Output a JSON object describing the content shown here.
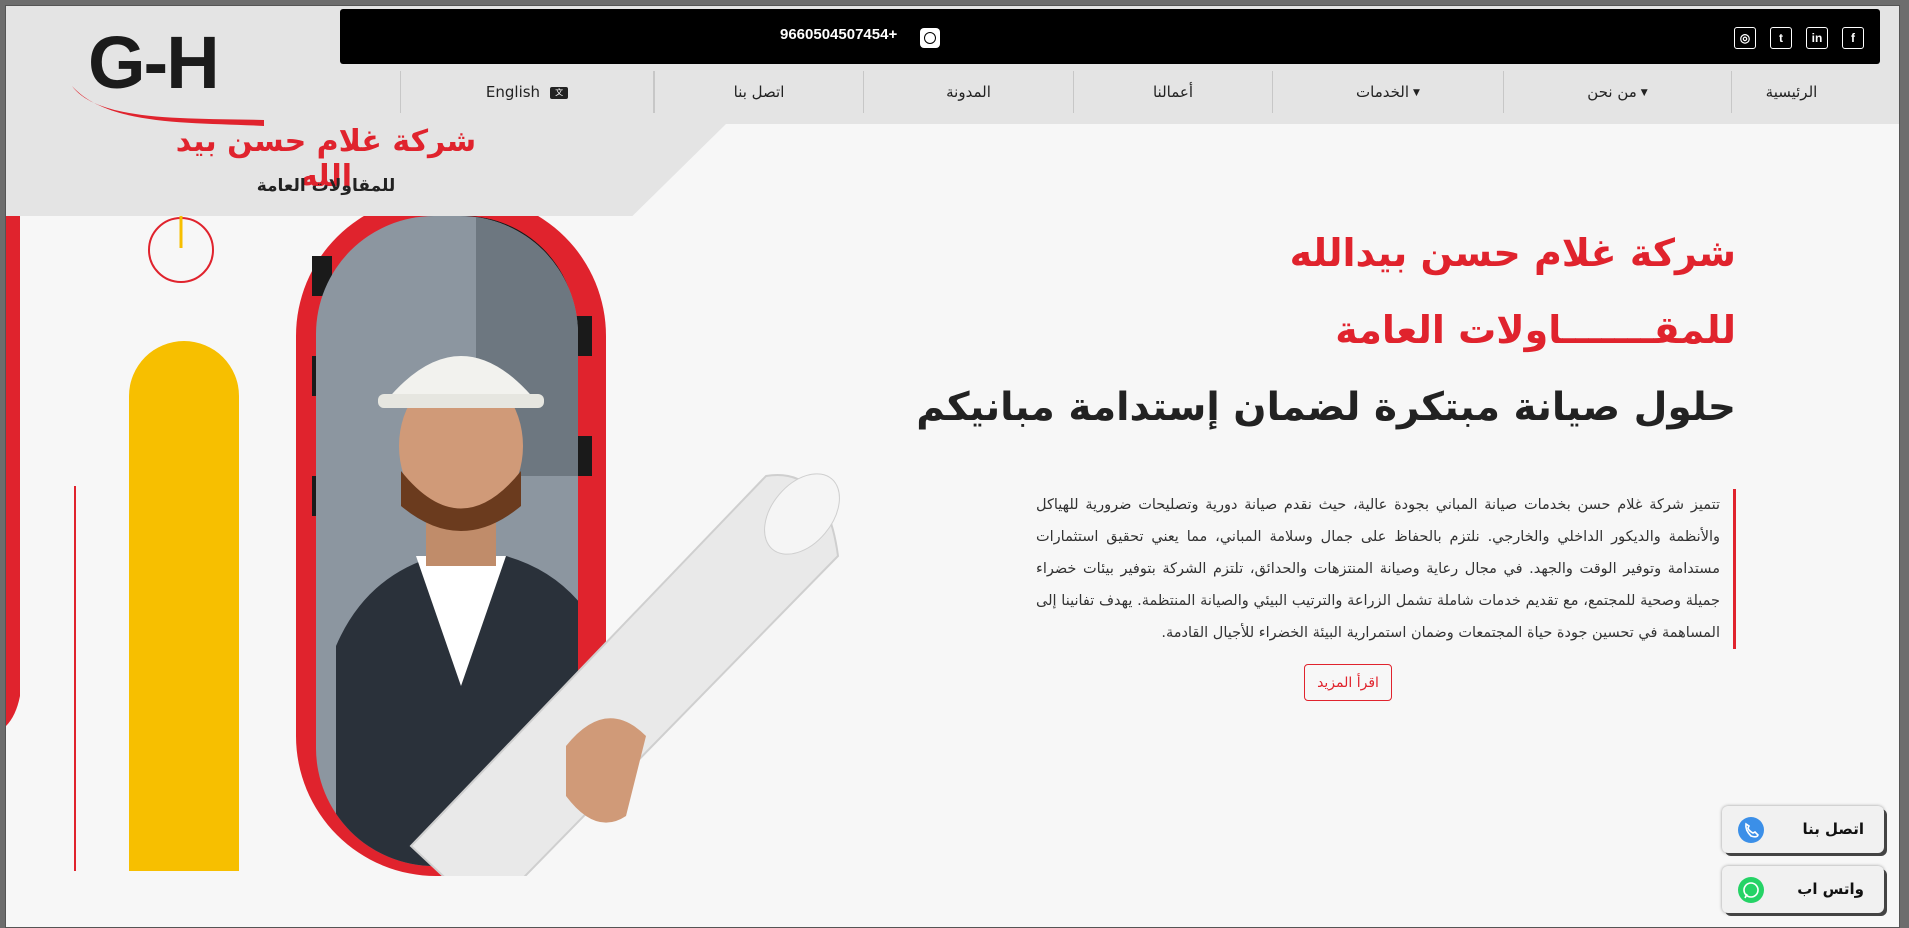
{
  "topbar": {
    "phone": "9660504507454+",
    "social": [
      "facebook",
      "linkedin",
      "twitter",
      "instagram"
    ]
  },
  "nav": {
    "home": "الرئيسية",
    "about": "من نحن",
    "services": "الخدمات",
    "works": "أعمالنا",
    "blog": "المدونة",
    "contact": "اتصل بنا",
    "language": "English"
  },
  "logo": {
    "mark": "G-H",
    "name": "شركة غلام حسن بيد الله",
    "subtitle": "للمقاولات العامة"
  },
  "hero": {
    "title_line1": "شركة غلام حسن بيدالله",
    "title_line2": "للمقـــــــاولات العامة",
    "title_line3": "حلول صيانة مبتكرة لضمان إستدامة مبانيكم",
    "body": "تتميز شركة غلام حسن بخدمات صيانة المباني بجودة عالية، حيث نقدم صيانة دورية وتصليحات ضرورية للهياكل والأنظمة والديكور الداخلي والخارجي. نلتزم بالحفاظ على جمال وسلامة المباني، مما يعني تحقيق استثمارات مستدامة وتوفير الوقت والجهد. في مجال رعاية وصيانة المنتزهات والحدائق، تلتزم الشركة بتوفير بيئات خضراء جميلة وصحية للمجتمع، مع تقديم خدمات شاملة تشمل الزراعة والترتيب البيئي والصيانة المنتظمة. يهدف تفانينا إلى المساهمة في تحسين جودة حياة المجتمعات وضمان استمرارية البيئة الخضراء للأجيال القادمة.",
    "read_more": "اقرأ المزيد"
  },
  "floating": {
    "call": "اتصل بنا",
    "whatsapp": "واتس اب"
  },
  "colors": {
    "accent": "#e0232d",
    "yellow": "#f7bf00",
    "whatsapp": "#25d366",
    "phone": "#3b8fe8"
  }
}
